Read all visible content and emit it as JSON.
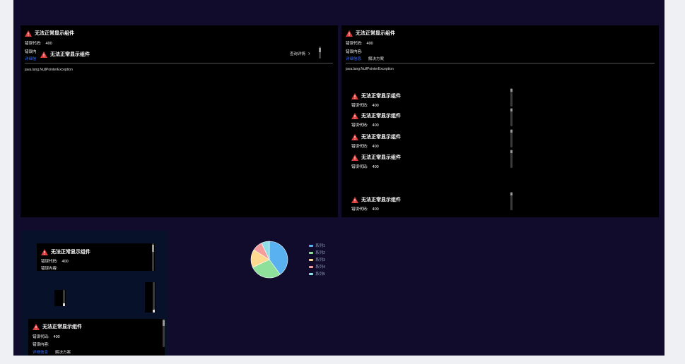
{
  "error": {
    "title": "无法正常显示组件",
    "code_label": "错误代码:",
    "code": "400",
    "content_label": "错误内容:",
    "detail_tab": "详细信息",
    "solution_tab": "解决方案",
    "exception": "java.lang.NullPointerException",
    "view_details": "查询详情",
    "truncated_content_label": "错误内",
    "truncated_detail_tab": "详细信"
  },
  "colors": {
    "background": "#110c2c",
    "panel": "#000000",
    "warning": "#e03a3a",
    "link": "#3b6bff"
  },
  "chart_data": {
    "type": "pie",
    "series_names": [
      "系列1",
      "系列2",
      "系列3",
      "系列4",
      "系列5"
    ],
    "values": [
      40,
      28,
      16,
      9,
      7
    ],
    "colors": [
      "#5ab1ef",
      "#8ee09a",
      "#ffd98f",
      "#f59c9c",
      "#8fdfe8"
    ]
  }
}
